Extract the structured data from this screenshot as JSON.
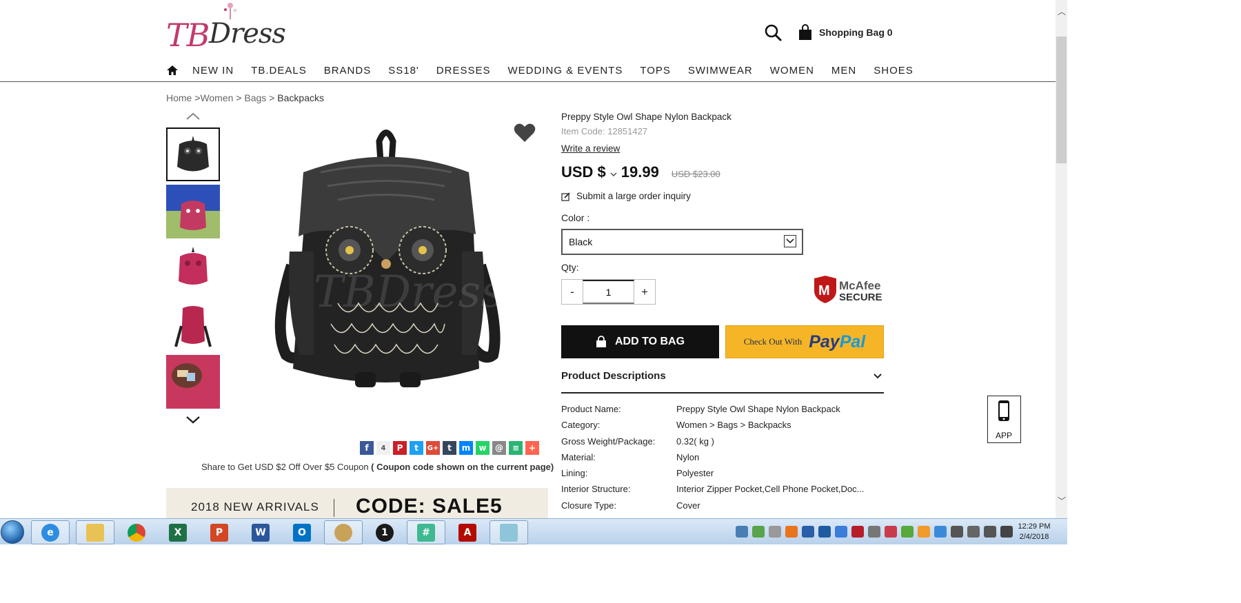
{
  "header": {
    "logo_text": "TBDress",
    "logo_tb": "TB",
    "logo_rest": "Dress",
    "shopping_bag_label": "Shopping Bag",
    "shopping_bag_count": "0"
  },
  "nav": {
    "items": [
      "NEW IN",
      "TB.DEALS",
      "BRANDS",
      "SS18'",
      "DRESSES",
      "WEDDING & EVENTS",
      "TOPS",
      "SWIMWEAR",
      "WOMEN",
      "MEN",
      "SHOES"
    ]
  },
  "breadcrumb": {
    "home": "Home",
    "sep1": " >",
    "women": "Women",
    "sep2": " > ",
    "bags": "Bags",
    "sep3": " > ",
    "current": "Backpacks"
  },
  "share": {
    "count": "4",
    "text_prefix": "Share to Get USD $2 Off Over $5 Coupon ",
    "text_bold": "( Coupon code shown on the current page)"
  },
  "banner": {
    "left_text": "2018 NEW ARRIVALS",
    "right_text": "CODE: SALE5"
  },
  "product": {
    "title": "Preppy Style Owl Shape Nylon Backpack",
    "item_code": "Item Code: 12851427",
    "write_review": "Write a review",
    "currency": "USD $",
    "price": "19.99",
    "old_price": "USD $23.00",
    "inquiry": "Submit a large order inquiry",
    "color_label": "Color :",
    "color_value": "Black",
    "qty_label": "Qty:",
    "qty_minus": "-",
    "qty_value": "1",
    "qty_plus": "+",
    "add_to_bag": "ADD TO BAG",
    "paypal_prefix": "Check Out With",
    "paypal_pay": "Pay",
    "paypal_pal": "Pal",
    "mcafee_line1": "McAfee",
    "mcafee_line2": "SECURE",
    "desc_heading": "Product Descriptions"
  },
  "specs": [
    {
      "k": "Product Name:",
      "v": "Preppy Style Owl Shape Nylon Backpack"
    },
    {
      "k": "Category:",
      "v": "Women > Bags > Backpacks"
    },
    {
      "k": "Gross Weight/Package:",
      "v": "0.32( kg )"
    },
    {
      "k": "Material:",
      "v": "Nylon"
    },
    {
      "k": "Lining:",
      "v": "Polyester"
    },
    {
      "k": "Interior Structure:",
      "v": "Interior Zipper Pocket,Cell Phone Pocket,Doc..."
    },
    {
      "k": "Closure Type:",
      "v": "Cover"
    }
  ],
  "app_button": "APP",
  "taskbar": {
    "clock_time": "12:29 PM",
    "clock_date": "2/4/2018"
  },
  "colors": {
    "brand_pink": "#c03a6d",
    "paypal_yellow": "#f6b527",
    "button_black": "#111111"
  }
}
